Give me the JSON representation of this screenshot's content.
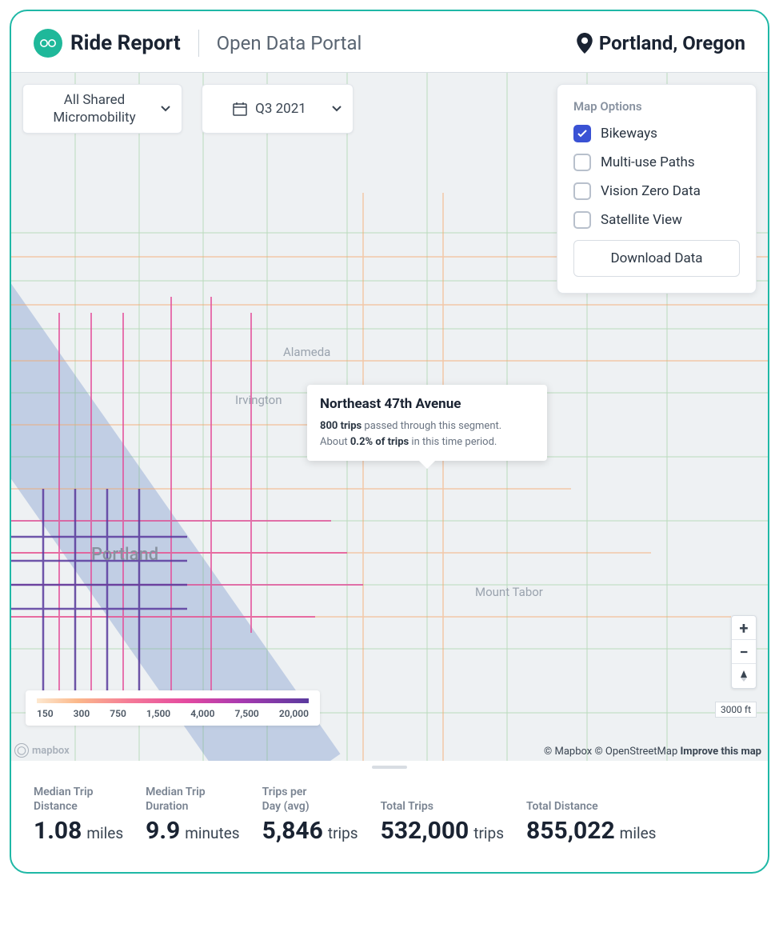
{
  "header": {
    "app_name": "Ride Report",
    "portal_title": "Open Data Portal",
    "location": "Portland, Oregon"
  },
  "filters": {
    "mobility_line1": "All Shared",
    "mobility_line2": "Micromobility",
    "period": "Q3 2021"
  },
  "map_options": {
    "title": "Map Options",
    "items": [
      {
        "label": "Bikeways",
        "checked": true
      },
      {
        "label": "Multi-use Paths",
        "checked": false
      },
      {
        "label": "Vision Zero Data",
        "checked": false
      },
      {
        "label": "Satellite View",
        "checked": false
      }
    ],
    "download_label": "Download Data"
  },
  "tooltip": {
    "title": "Northeast 47th Avenue",
    "trips_count": "800 trips",
    "line1_rest": " passed through this segment.",
    "line2_prefix": "About ",
    "pct": "0.2% of trips",
    "line2_rest": " in this time period."
  },
  "map_labels": {
    "alameda": "Alameda",
    "irvington": "Irvington",
    "portland": "Portland",
    "mount_tabor": "Mount Tabor"
  },
  "legend": {
    "ticks": [
      "150",
      "300",
      "750",
      "1,500",
      "4,000",
      "7,500",
      "20,000"
    ]
  },
  "map_meta": {
    "mapbox_logo": "mapbox",
    "scale": "3000 ft",
    "attrib_mapbox": "© Mapbox",
    "attrib_osm": "© OpenStreetMap",
    "improve": "Improve this map"
  },
  "stats": [
    {
      "label": "Median Trip Distance",
      "value": "1.08",
      "unit": "miles"
    },
    {
      "label": "Median Trip Duration",
      "value": "9.9",
      "unit": "minutes"
    },
    {
      "label": "Trips per Day (avg)",
      "value": "5,846",
      "unit": "trips"
    },
    {
      "label": "Total Trips",
      "value": "532,000",
      "unit": "trips"
    },
    {
      "label": "Total Distance",
      "value": "855,022",
      "unit": "miles"
    }
  ]
}
